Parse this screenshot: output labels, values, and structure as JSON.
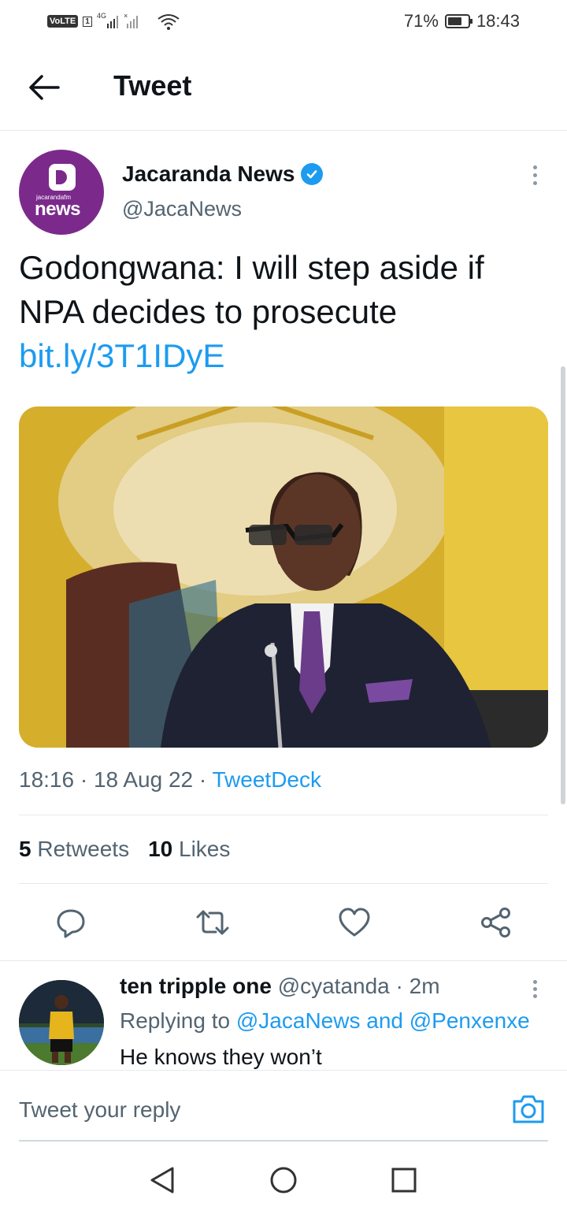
{
  "status_bar": {
    "volte": "VoLTE",
    "sim": "1",
    "network": "4G",
    "battery": "71%",
    "battery_level": 0.71,
    "time": "18:43"
  },
  "header": {
    "title": "Tweet"
  },
  "tweet": {
    "avatar_brand_small": "jacarandafm",
    "avatar_brand_text": "news",
    "author_name": "Jacaranda News",
    "author_handle": "@JacaNews",
    "text": "Godongwana: I will step aside if NPA decides to prosecute",
    "link": "bit.ly/3T1IDyE",
    "time": "18:16",
    "date": "18 Aug 22",
    "client": "TweetDeck",
    "retweets_count": "5",
    "retweets_label": "Retweets",
    "likes_count": "10",
    "likes_label": "Likes"
  },
  "reply": {
    "name": "ten tripple one",
    "handle": "@cyatanda",
    "time": "2m",
    "replying_label": "Replying to",
    "mention_1": "@JacaNews",
    "and": "and",
    "mention_2": "@Penxenxe",
    "text": "He knows they won’t"
  },
  "compose": {
    "placeholder": "Tweet your reply"
  },
  "colors": {
    "accent": "#1d9bf0",
    "brand": "#7b2a8c",
    "muted": "#536471",
    "text": "#0f1419"
  },
  "icons": {
    "back": "arrow-left-icon",
    "verified": "verified-badge-icon",
    "more": "more-vertical-icon",
    "reply": "reply-icon",
    "retweet": "retweet-icon",
    "like": "heart-icon",
    "share": "share-icon",
    "camera": "camera-icon",
    "nav_back": "triangle-back-icon",
    "nav_home": "circle-home-icon",
    "nav_recent": "square-recent-icon"
  }
}
